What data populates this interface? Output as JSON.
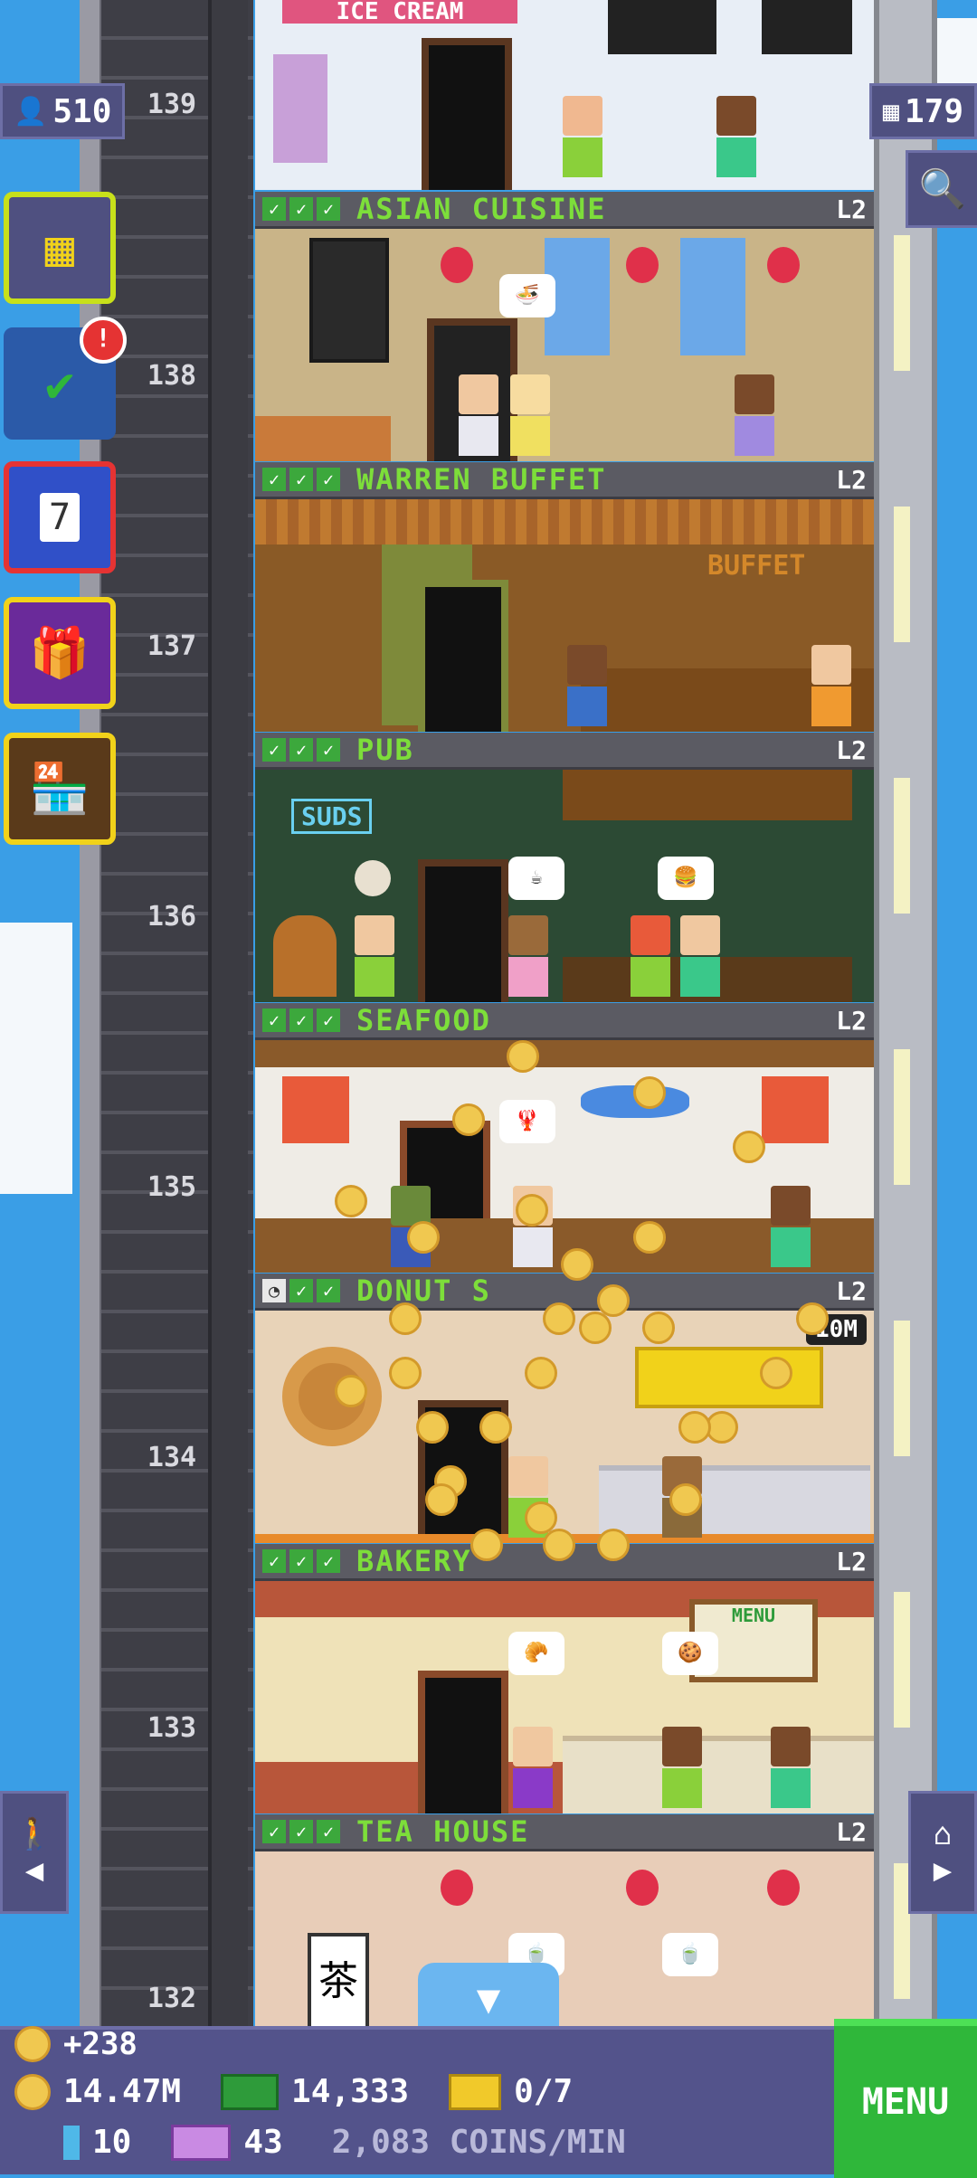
{
  "top_left_badge": {
    "icon": "person-icon",
    "value": "510"
  },
  "top_right_badge": {
    "icon": "building-icon",
    "value": "179"
  },
  "floors": [
    {
      "number": "139",
      "name": "ICE CREAM",
      "level": ""
    },
    {
      "number": "138",
      "name": "ASIAN CUISINE",
      "level": "L2"
    },
    {
      "number": "137",
      "name": "WARREN BUFFET",
      "level": "L2",
      "sign": "BUFFET"
    },
    {
      "number": "136",
      "name": "PUB",
      "level": "L2",
      "sign": "SUDS"
    },
    {
      "number": "135",
      "name": "SEAFOOD",
      "level": "L2"
    },
    {
      "number": "134",
      "name": "DONUT S",
      "level": "L2",
      "timer": "10M"
    },
    {
      "number": "133",
      "name": "BAKERY",
      "level": "L2",
      "sign": "MENU"
    },
    {
      "number": "132",
      "name": "TEA HOUSE",
      "level": "L2",
      "sign": "茶"
    }
  ],
  "side_buttons": [
    {
      "name": "building-grid",
      "icon": "building-grid-icon"
    },
    {
      "name": "missions",
      "icon": "checklist-icon",
      "badge": "!"
    },
    {
      "name": "calendar",
      "icon": "calendar-icon",
      "day": "7"
    },
    {
      "name": "gift",
      "icon": "gift-icon"
    },
    {
      "name": "market",
      "icon": "market-stall-icon"
    }
  ],
  "hud": {
    "coins_gain": "+238",
    "coins": "14.47M",
    "bux": "14,333",
    "tickets": "0/7",
    "bitizens": "10",
    "tower_bux": "43",
    "rate": "2,083 COINS/MIN",
    "menu": "MENU"
  }
}
